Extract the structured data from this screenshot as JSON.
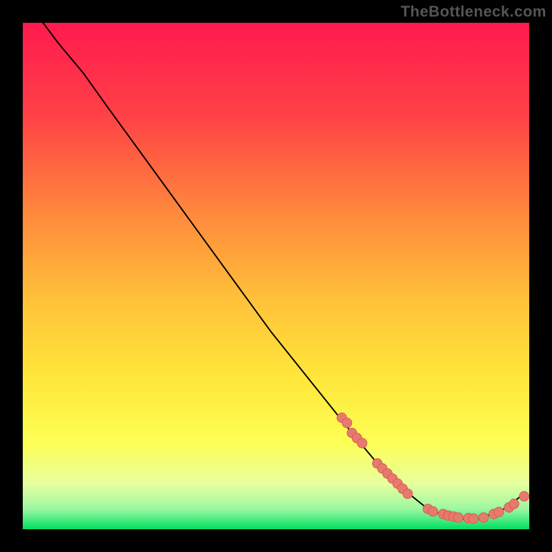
{
  "watermark": "TheBottleneck.com",
  "colors": {
    "background": "#000000",
    "gradient_top": "#ff1a4f",
    "gradient_mid1": "#ff5a3c",
    "gradient_mid2": "#ffb13a",
    "gradient_mid3": "#ffe63a",
    "gradient_mid4": "#f8ff6a",
    "gradient_bottom": "#00e060",
    "curve_stroke": "#000000",
    "marker_fill": "#e77a6f",
    "marker_stroke": "#d95a4c"
  },
  "chart_data": {
    "type": "line",
    "title": "",
    "xlabel": "",
    "ylabel": "",
    "xlim": [
      0,
      100
    ],
    "ylim": [
      0,
      100
    ],
    "grid": false,
    "legend": false,
    "curve": [
      {
        "x": 4,
        "y": 100
      },
      {
        "x": 7,
        "y": 96
      },
      {
        "x": 12,
        "y": 90
      },
      {
        "x": 17,
        "y": 83
      },
      {
        "x": 25,
        "y": 72
      },
      {
        "x": 33,
        "y": 61
      },
      {
        "x": 41,
        "y": 50
      },
      {
        "x": 49,
        "y": 39
      },
      {
        "x": 57,
        "y": 29
      },
      {
        "x": 65,
        "y": 19
      },
      {
        "x": 70,
        "y": 13
      },
      {
        "x": 75,
        "y": 8
      },
      {
        "x": 80,
        "y": 4
      },
      {
        "x": 85,
        "y": 2
      },
      {
        "x": 90,
        "y": 2
      },
      {
        "x": 95,
        "y": 4
      },
      {
        "x": 99,
        "y": 7
      }
    ],
    "markers": [
      {
        "x": 63,
        "y": 22
      },
      {
        "x": 64,
        "y": 21
      },
      {
        "x": 65,
        "y": 19
      },
      {
        "x": 66,
        "y": 18
      },
      {
        "x": 67,
        "y": 17
      },
      {
        "x": 70,
        "y": 13
      },
      {
        "x": 71,
        "y": 12
      },
      {
        "x": 72,
        "y": 11
      },
      {
        "x": 73,
        "y": 10
      },
      {
        "x": 74,
        "y": 9
      },
      {
        "x": 75,
        "y": 8
      },
      {
        "x": 76,
        "y": 7
      },
      {
        "x": 80,
        "y": 4
      },
      {
        "x": 81,
        "y": 3.5
      },
      {
        "x": 83,
        "y": 3
      },
      {
        "x": 84,
        "y": 2.7
      },
      {
        "x": 85,
        "y": 2.5
      },
      {
        "x": 86,
        "y": 2.3
      },
      {
        "x": 88,
        "y": 2.2
      },
      {
        "x": 89,
        "y": 2.1
      },
      {
        "x": 91,
        "y": 2.3
      },
      {
        "x": 93,
        "y": 3
      },
      {
        "x": 94,
        "y": 3.4
      },
      {
        "x": 96,
        "y": 4.3
      },
      {
        "x": 97,
        "y": 5
      },
      {
        "x": 99,
        "y": 6.5
      }
    ]
  }
}
